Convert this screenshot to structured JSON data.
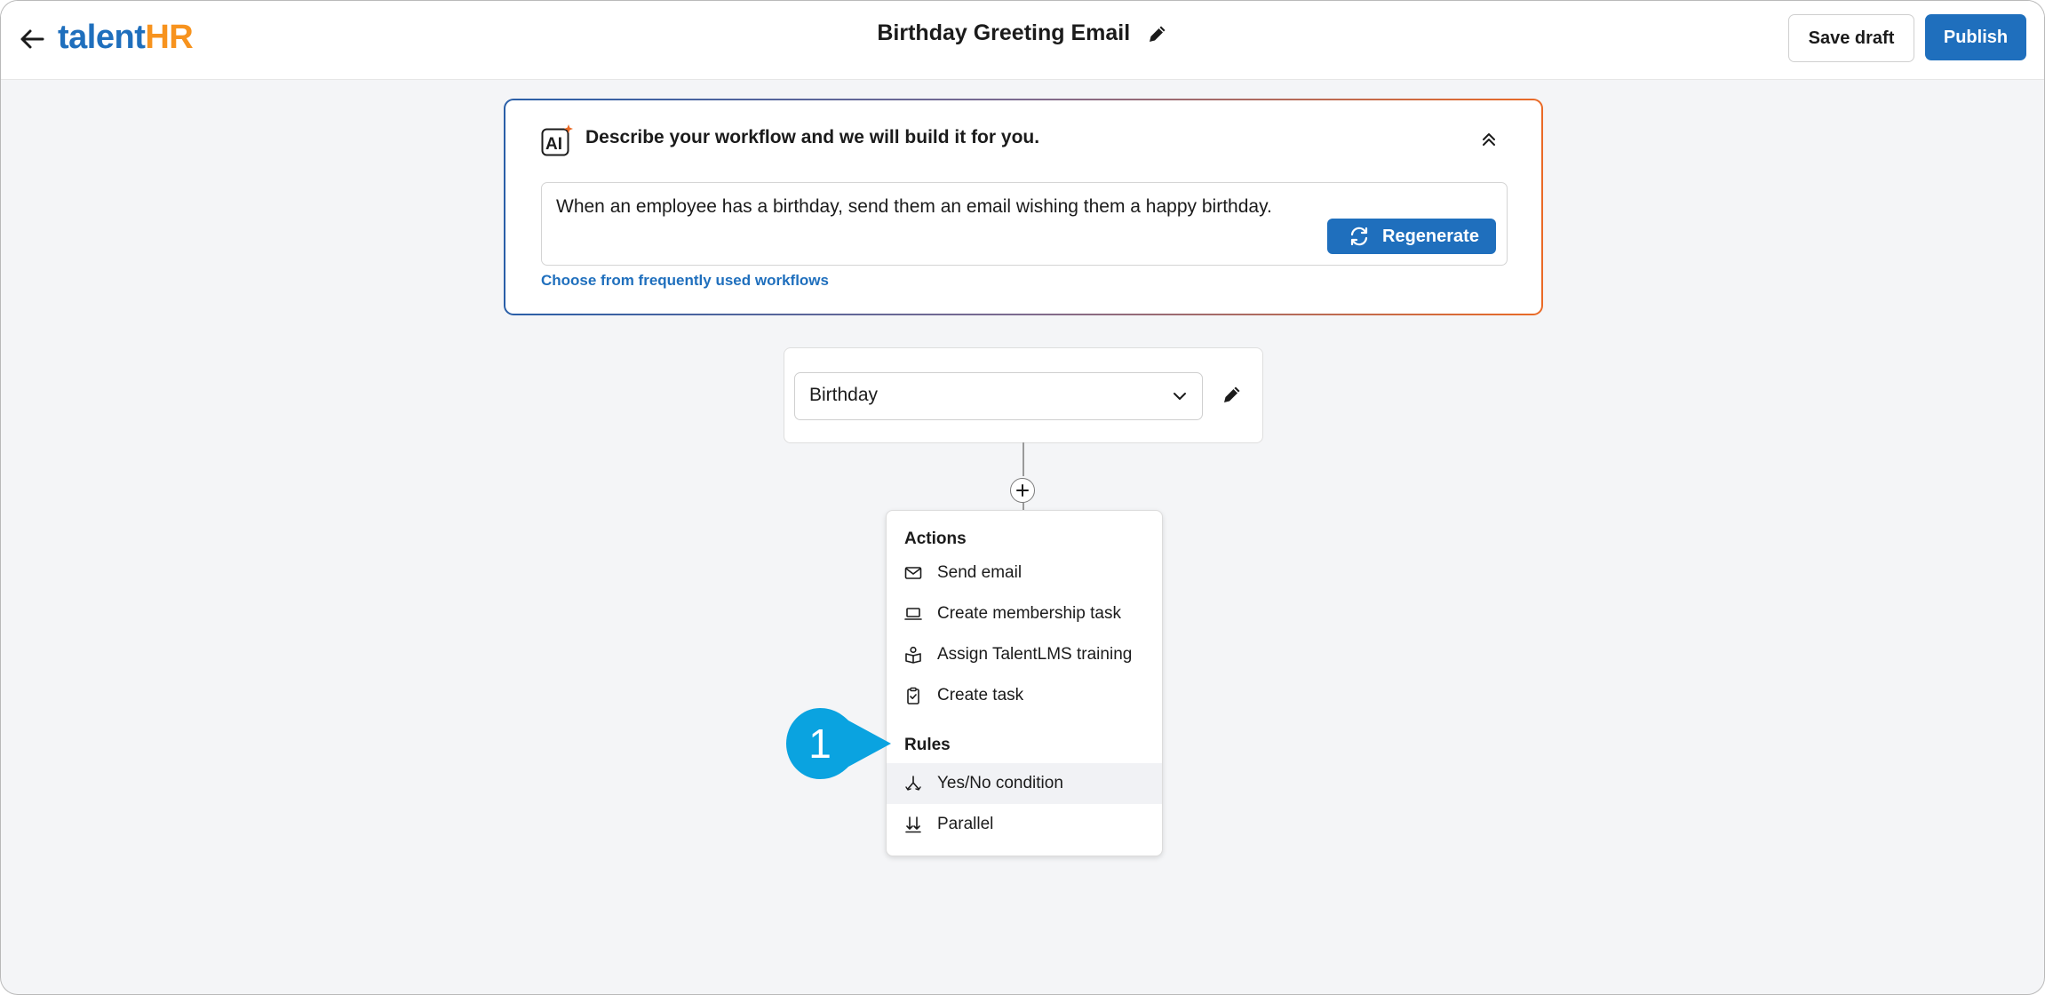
{
  "header": {
    "logo_part1": "talent",
    "logo_part2": "HR",
    "title": "Birthday Greeting Email",
    "save_draft_label": "Save draft",
    "publish_label": "Publish"
  },
  "ai_panel": {
    "icon_text": "AI",
    "heading": "Describe your workflow and we will build it for you.",
    "prompt": "When an employee has a birthday, send them an email wishing them a happy birthday.",
    "regenerate_label": "Regenerate",
    "frequent_link": "Choose from frequently used workflows"
  },
  "trigger": {
    "selected": "Birthday"
  },
  "menu": {
    "actions_title": "Actions",
    "actions": [
      {
        "label": "Send email",
        "icon": "mail-icon"
      },
      {
        "label": "Create membership task",
        "icon": "laptop-icon"
      },
      {
        "label": "Assign TalentLMS training",
        "icon": "training-icon"
      },
      {
        "label": "Create task",
        "icon": "clipboard-check-icon"
      }
    ],
    "rules_title": "Rules",
    "rules": [
      {
        "label": "Yes/No condition",
        "icon": "split-icon",
        "highlighted": true
      },
      {
        "label": "Parallel",
        "icon": "parallel-arrows-icon"
      }
    ]
  },
  "callout": {
    "number": "1"
  },
  "colors": {
    "brand_blue": "#1f6fbd",
    "brand_orange": "#f7931e",
    "callout_blue": "#0aa3e0"
  }
}
